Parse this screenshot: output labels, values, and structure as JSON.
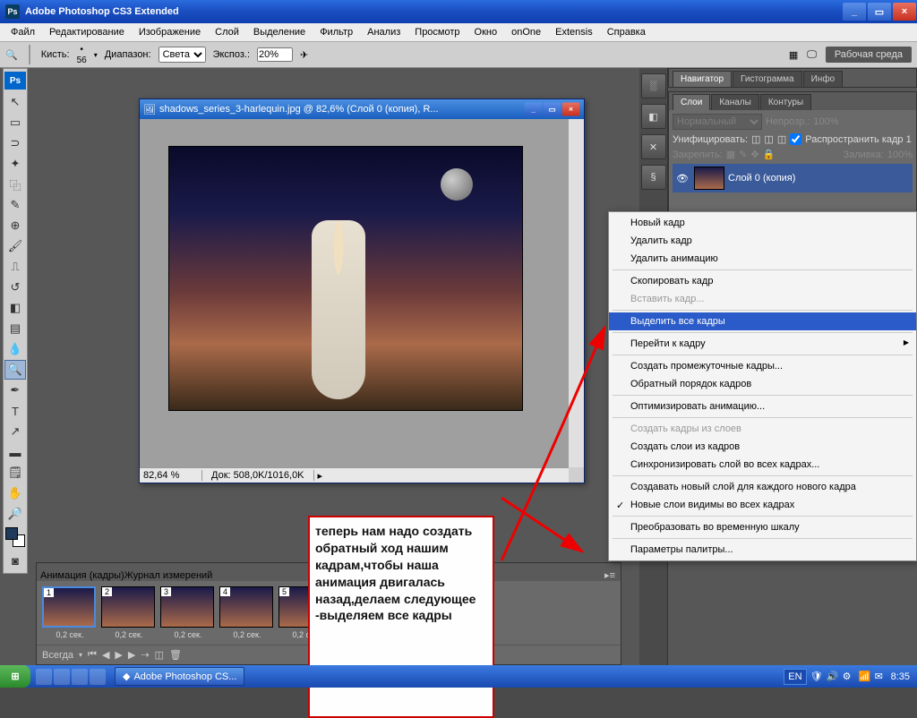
{
  "titlebar": {
    "app": "Adobe Photoshop CS3 Extended"
  },
  "menu": [
    "Файл",
    "Редактирование",
    "Изображение",
    "Слой",
    "Выделение",
    "Фильтр",
    "Анализ",
    "Просмотр",
    "Окно",
    "onOne",
    "Extensis",
    "Справка"
  ],
  "optbar": {
    "brush_label": "Кисть:",
    "brush_size": "56",
    "range_label": "Диапазон:",
    "range_value": "Света",
    "expo_label": "Экспоз.:",
    "expo_value": "20%",
    "workspace": "Рабочая среда"
  },
  "doc": {
    "title": "shadows_series_3-harlequin.jpg @ 82,6% (Слой 0 (копия), R...",
    "zoom": "82,64 %",
    "status": "Док: 508,0K/1016,0K"
  },
  "nav_tabs": [
    "Навигатор",
    "Гистограмма",
    "Инфо"
  ],
  "layer_tabs": [
    "Слои",
    "Каналы",
    "Контуры"
  ],
  "layer_panel": {
    "mode": "Нормальный",
    "opacity_label": "Непрозр.:",
    "opacity": "100%",
    "unify": "Унифицировать:",
    "propagate": "Распространить кадр 1",
    "lock": "Закрепить:",
    "fill_label": "Заливка:",
    "fill": "100%",
    "layer_name": "Слой 0 (копия)"
  },
  "ctx": [
    {
      "t": "Новый кадр"
    },
    {
      "t": "Удалить кадр"
    },
    {
      "t": "Удалить анимацию"
    },
    {
      "sep": true
    },
    {
      "t": "Скопировать кадр"
    },
    {
      "t": "Вставить кадр...",
      "dis": true
    },
    {
      "sep": true
    },
    {
      "t": "Выделить все кадры",
      "hl": true
    },
    {
      "sep": true
    },
    {
      "t": "Перейти к кадру",
      "sub": true
    },
    {
      "sep": true
    },
    {
      "t": "Создать промежуточные кадры..."
    },
    {
      "t": "Обратный порядок кадров"
    },
    {
      "sep": true
    },
    {
      "t": "Оптимизировать анимацию..."
    },
    {
      "sep": true
    },
    {
      "t": "Создать кадры из слоев",
      "dis": true
    },
    {
      "t": "Создать слои из кадров"
    },
    {
      "t": "Синхронизировать слой во всех кадрах..."
    },
    {
      "sep": true
    },
    {
      "t": "Создавать новый слой для каждого нового кадра"
    },
    {
      "t": "Новые слои видимы во всех кадрах",
      "chk": true
    },
    {
      "sep": true
    },
    {
      "t": "Преобразовать во временную шкалу"
    },
    {
      "sep": true
    },
    {
      "t": "Параметры палитры..."
    }
  ],
  "anim": {
    "tabs": [
      "Анимация (кадры)",
      "Журнал измерений"
    ],
    "frame_time": "0,2 сек.",
    "loop": "Всегда",
    "frames": [
      1,
      2,
      3,
      4,
      5
    ]
  },
  "annot": "теперь нам надо создать обратный ход нашим кадрам,чтобы наша анимация двигалась назад,делаем следующее\n-выделяем все кадры",
  "taskbar": {
    "app": "Adobe Photoshop CS...",
    "lang": "EN",
    "time": "8:35"
  }
}
